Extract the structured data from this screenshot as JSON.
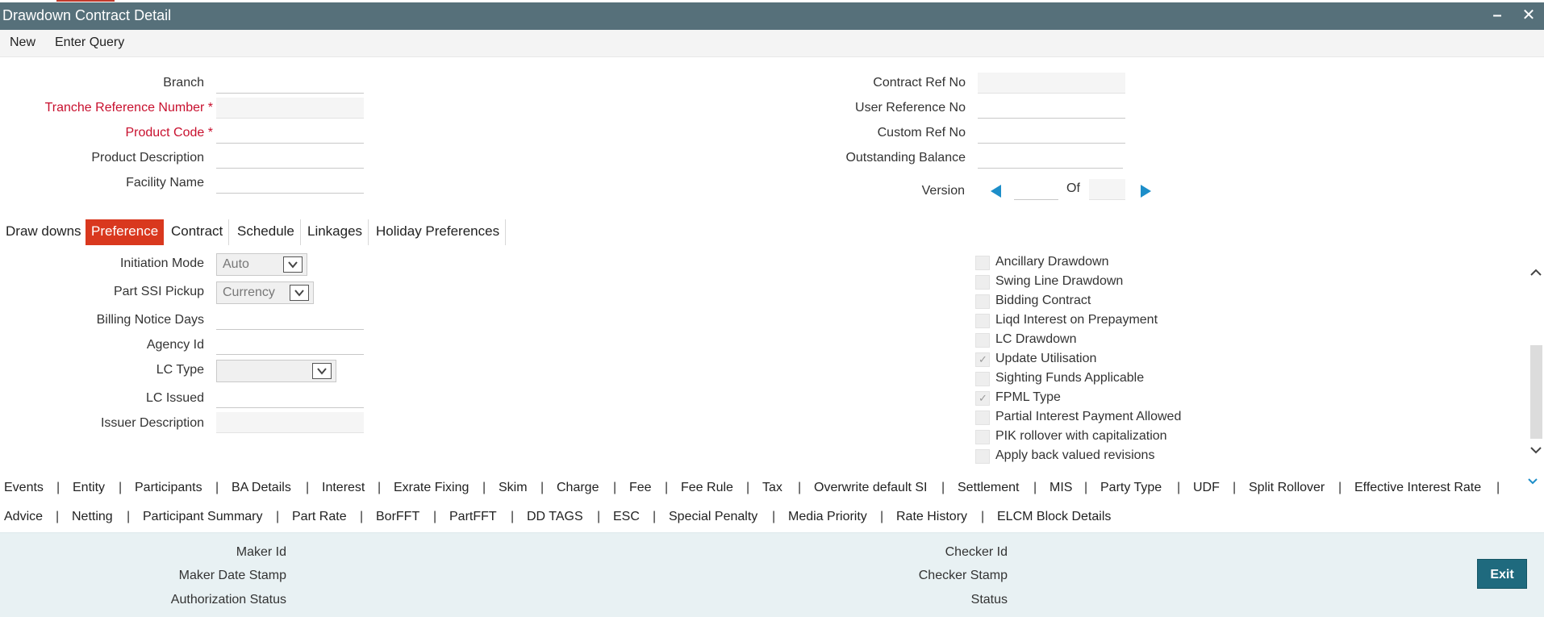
{
  "window": {
    "title": "Drawdown Contract Detail"
  },
  "menu": {
    "new": "New",
    "enter_query": "Enter Query"
  },
  "header_left": {
    "branch": {
      "label": "Branch",
      "value": ""
    },
    "tranche_ref": {
      "label": "Tranche Reference Number",
      "required": "*",
      "value": ""
    },
    "product_code": {
      "label": "Product Code",
      "required": "*",
      "value": ""
    },
    "product_description": {
      "label": "Product Description",
      "value": ""
    },
    "facility_name": {
      "label": "Facility Name",
      "value": ""
    }
  },
  "header_right": {
    "contract_ref_no": {
      "label": "Contract Ref No",
      "value": ""
    },
    "user_ref_no": {
      "label": "User Reference No",
      "value": ""
    },
    "custom_ref_no": {
      "label": "Custom Ref No",
      "value": ""
    },
    "outstanding_balance": {
      "label": "Outstanding Balance",
      "value": ""
    },
    "version": {
      "label": "Version",
      "of": "Of",
      "current": "",
      "total": ""
    }
  },
  "tabs": [
    "Draw downs",
    "Preference",
    "Contract",
    "Schedule",
    "Linkages",
    "Holiday Preferences"
  ],
  "active_tab": "Preference",
  "preference": {
    "initiation_mode": {
      "label": "Initiation Mode",
      "value": "Auto"
    },
    "part_ssi_pickup": {
      "label": "Part SSI Pickup",
      "value": "Currency"
    },
    "billing_notice_days": {
      "label": "Billing Notice Days",
      "value": ""
    },
    "agency_id": {
      "label": "Agency Id",
      "value": ""
    },
    "lc_type": {
      "label": "LC Type",
      "value": ""
    },
    "lc_issued": {
      "label": "LC Issued",
      "value": ""
    },
    "issuer_description": {
      "label": "Issuer Description",
      "value": ""
    }
  },
  "checkboxes": [
    {
      "label": "Ancillary Drawdown",
      "checked": false
    },
    {
      "label": "Swing Line Drawdown",
      "checked": false
    },
    {
      "label": "Bidding Contract",
      "checked": false
    },
    {
      "label": "Liqd Interest on Prepayment",
      "checked": false
    },
    {
      "label": "LC Drawdown",
      "checked": false
    },
    {
      "label": "Update Utilisation",
      "checked": true
    },
    {
      "label": "Sighting Funds Applicable",
      "checked": false
    },
    {
      "label": "FPML Type",
      "checked": true
    },
    {
      "label": "Partial Interest Payment Allowed",
      "checked": false
    },
    {
      "label": "PIK rollover with capitalization",
      "checked": false
    },
    {
      "label": "Apply back valued revisions",
      "checked": false
    }
  ],
  "links_row1": [
    "Events",
    "Entity",
    "Participants",
    "BA Details",
    "Interest",
    "Exrate Fixing",
    "Skim",
    "Charge",
    "Fee",
    "Fee Rule",
    "Tax",
    "Overwrite default SI",
    "Settlement",
    "MIS",
    "Party Type",
    "UDF",
    "Split Rollover",
    "Effective Interest Rate"
  ],
  "links_row2": [
    "Advice",
    "Netting",
    "Participant Summary",
    "Part Rate",
    "BorFFT",
    "PartFFT",
    "DD TAGS",
    "ESC",
    "Special Penalty",
    "Media Priority",
    "Rate History",
    "ELCM Block Details"
  ],
  "link_separator": "|",
  "footer": {
    "maker_id": "Maker Id",
    "maker_date_stamp": "Maker Date Stamp",
    "authorization_status": "Authorization Status",
    "checker_id": "Checker Id",
    "checker_stamp": "Checker Stamp",
    "status": "Status",
    "exit": "Exit"
  },
  "icons": {
    "minimize": "minimize-icon",
    "close": "close-icon",
    "prev": "triangle-left-icon",
    "next": "triangle-right-icon",
    "select_arrow": "chevron-down-icon",
    "scroll_up": "chevron-up-icon",
    "scroll_down": "chevron-down-icon"
  },
  "colors": {
    "titlebar": "#56707a",
    "required": "#c8102e",
    "active_tab": "#d9381e",
    "nav_arrow": "#1d8ec9",
    "footer_bg": "#e8f1f3",
    "exit_button": "#1f6a7e"
  }
}
